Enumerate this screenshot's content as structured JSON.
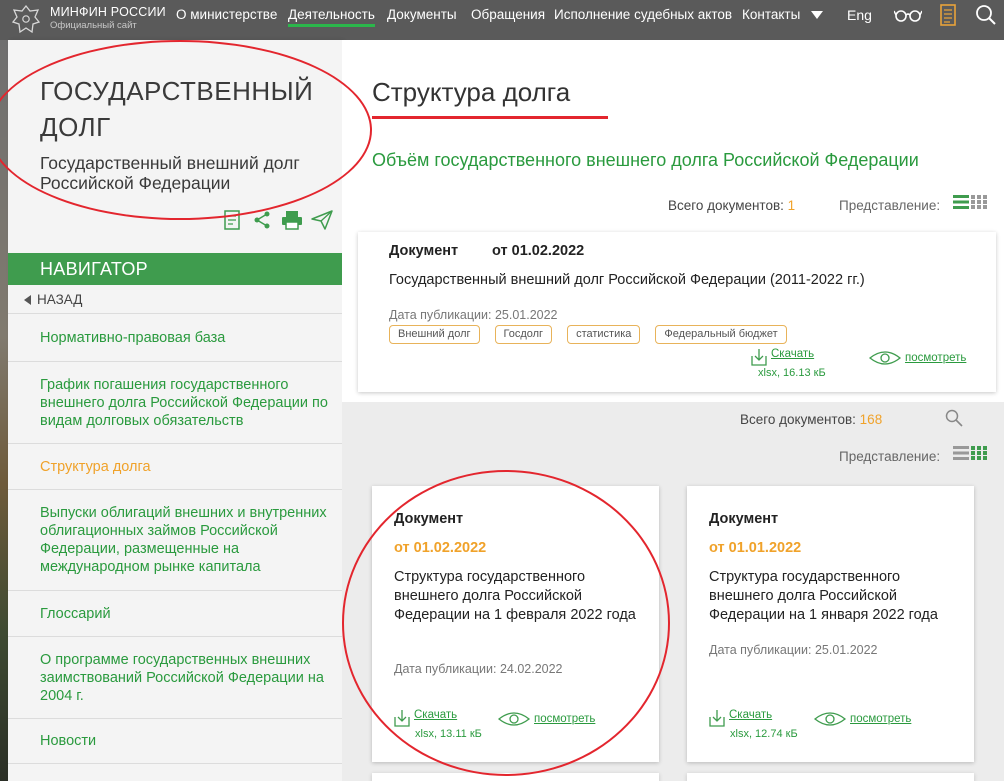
{
  "brand": {
    "name": "МИНФИН РОССИИ",
    "subtitle": "Официальный сайт"
  },
  "top_nav": [
    "О министерстве",
    "Деятельность",
    "Документы",
    "Обращения",
    "Исполнение судебных актов",
    "Контакты"
  ],
  "top_nav_active": "Деятельность",
  "lang": "Eng",
  "sidebar": {
    "title": "ГОСУДАРСТВЕННЫЙ ДОЛГ",
    "subtitle": "Государственный внешний долг Российской Федерации",
    "navigator_label": "НАВИГАТОР",
    "back_label": "НАЗАД",
    "items": [
      "Нормативно-правовая база",
      "График погашения государственного внешнего долга Российской Федерации по видам долговых обязательств",
      "Структура долга",
      "Выпуски облигаций внешних и внутренних облигационных займов Российской Федерации, размещенные на международном рынке капитала",
      "Глоссарий",
      "О программе государственных внешних заимствований Российской Федерации на 2004 г.",
      "Новости"
    ],
    "active_item": "Структура долга"
  },
  "main": {
    "page_title": "Структура долга",
    "section_title": "Объём государственного внешнего долга Российской Федерации",
    "total_label": "Всего документов:",
    "total_top": "1",
    "total_bottom": "168",
    "view_label": "Представление:"
  },
  "featured_doc": {
    "kind": "Документ",
    "date": "от 01.02.2022",
    "description": "Государственный внешний долг Российской Федерации (2011-2022 гг.)",
    "published": "Дата публикации: 25.01.2022",
    "tags": [
      "Внешний долг",
      "Госдолг",
      "статистика",
      "Федеральный бюджет"
    ],
    "download_label": "Скачать",
    "file_info": "xlsx, 16.13 кБ",
    "view_label": "посмотреть"
  },
  "cards": [
    {
      "kind": "Документ",
      "date": "от 01.02.2022",
      "title": "Структура государственного внешнего долга Российской Федерации на 1 февраля 2022 года",
      "published": "Дата публикации: 24.02.2022",
      "download_label": "Скачать",
      "file_info": "xlsx, 13.11 кБ",
      "view_label": "посмотреть"
    },
    {
      "kind": "Документ",
      "date": "от 01.01.2022",
      "title": "Структура государственного внешнего долга Российской Федерации на 1 января 2022 года",
      "published": "Дата публикации: 25.01.2022",
      "download_label": "Скачать",
      "file_info": "xlsx, 12.74 кБ",
      "view_label": "посмотреть"
    }
  ],
  "colors": {
    "accent_green": "#2a9a3e",
    "navigator_green": "#3f9c4e",
    "orange": "#f0a22a",
    "topbar": "#5a5a5a",
    "annotation_red": "#e3262e"
  }
}
